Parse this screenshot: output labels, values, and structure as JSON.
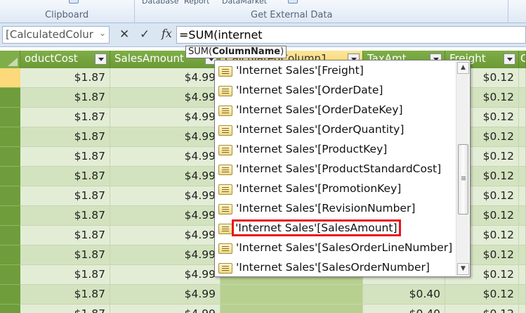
{
  "ribbon": {
    "groups": [
      "Clipboard",
      "Get External Data"
    ],
    "truncated_items": [
      "Database",
      "Report",
      "DataMarket"
    ]
  },
  "formula_bar": {
    "name_box": "[CalculatedColur",
    "cancel_symbol": "✕",
    "enter_symbol": "✓",
    "fx_label": "fx",
    "formula": "=SUM(internet",
    "tooltip_func": "SUM(",
    "tooltip_param": "ColumnName",
    "tooltip_end": ")"
  },
  "grid": {
    "columns": [
      "oductCost",
      "SalesAmount",
      "CalculatedColumn1",
      "TaxAmt",
      "Freight",
      "C"
    ],
    "rows": [
      {
        "productCost": "$1.87",
        "salesAmount": "$4.99",
        "taxAmt": "",
        "freight": "$0.12"
      },
      {
        "productCost": "$1.87",
        "salesAmount": "$4.99",
        "taxAmt": "",
        "freight": "$0.12"
      },
      {
        "productCost": "$1.87",
        "salesAmount": "$4.99",
        "taxAmt": "",
        "freight": "$0.12"
      },
      {
        "productCost": "$1.87",
        "salesAmount": "$4.99",
        "taxAmt": "",
        "freight": "$0.12"
      },
      {
        "productCost": "$1.87",
        "salesAmount": "$4.99",
        "taxAmt": "",
        "freight": "$0.12"
      },
      {
        "productCost": "$1.87",
        "salesAmount": "$4.99",
        "taxAmt": "",
        "freight": "$0.12"
      },
      {
        "productCost": "$1.87",
        "salesAmount": "$4.99",
        "taxAmt": "",
        "freight": "$0.12"
      },
      {
        "productCost": "$1.87",
        "salesAmount": "$4.99",
        "taxAmt": "",
        "freight": "$0.12"
      },
      {
        "productCost": "$1.87",
        "salesAmount": "$4.99",
        "taxAmt": "",
        "freight": "$0.12"
      },
      {
        "productCost": "$1.87",
        "salesAmount": "$4.99",
        "taxAmt": "",
        "freight": "$0.12"
      },
      {
        "productCost": "$1.87",
        "salesAmount": "$4.99",
        "taxAmt": "",
        "freight": "$0.12"
      },
      {
        "productCost": "$1.87",
        "salesAmount": "$4.99",
        "taxAmt": "$0.40",
        "freight": "$0.12"
      },
      {
        "productCost": "$1.87",
        "salesAmount": "$4.99",
        "taxAmt": "$0.40",
        "freight": "$0.12"
      }
    ]
  },
  "autocomplete": {
    "items": [
      "'Internet Sales'[Freight]",
      "'Internet Sales'[OrderDate]",
      "'Internet Sales'[OrderDateKey]",
      "'Internet Sales'[OrderQuantity]",
      "'Internet Sales'[ProductKey]",
      "'Internet Sales'[ProductStandardCost]",
      "'Internet Sales'[PromotionKey]",
      "'Internet Sales'[RevisionNumber]",
      "'Internet Sales'[SalesAmount]",
      "'Internet Sales'[SalesOrderLineNumber]",
      "'Internet Sales'[SalesOrderNumber]"
    ],
    "highlighted_index": 8,
    "highlight_color": "#e8161b",
    "item_icon": "column-table-icon"
  },
  "colors": {
    "header_green": "#7fae48",
    "cell_even": "#e3edd6",
    "cell_odd": "#d3e3bf",
    "selected_column": "#b7d08f"
  }
}
